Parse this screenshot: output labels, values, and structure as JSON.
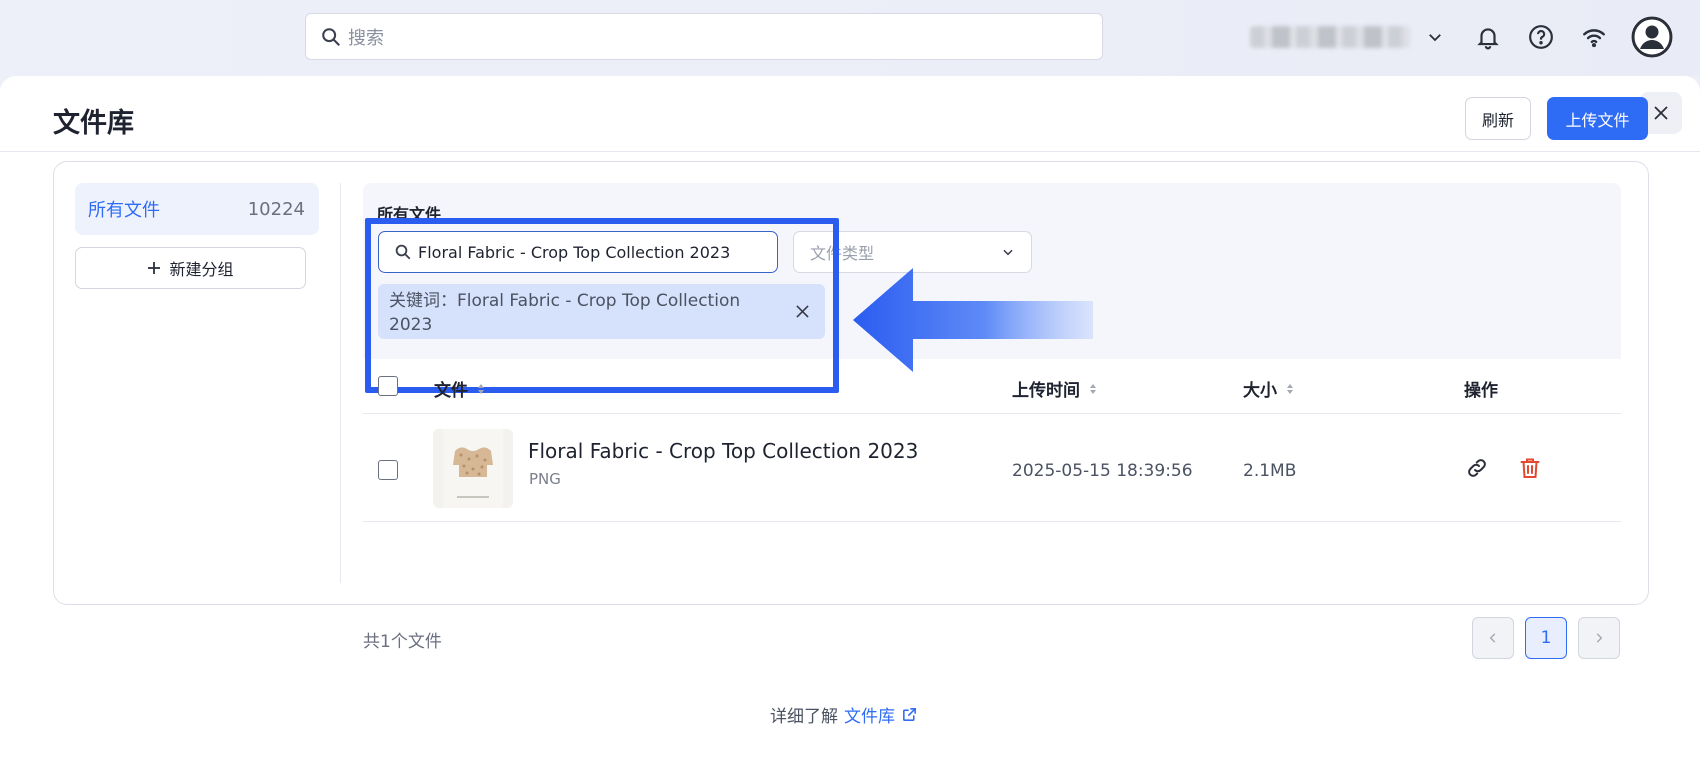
{
  "topbar": {
    "search_placeholder": "搜索"
  },
  "page": {
    "title": "文件库",
    "refresh_label": "刷新",
    "upload_label": "上传文件"
  },
  "sidebar": {
    "all_files_label": "所有文件",
    "all_files_count": "10224",
    "new_group_label": "新建分组"
  },
  "filter": {
    "section_title": "所有文件",
    "keyword_value": "Floral Fabric - Crop Top Collection 2023",
    "type_placeholder": "文件类型",
    "active_tag": "关键词：Floral Fabric - Crop Top Collection 2023"
  },
  "table": {
    "headers": {
      "file": "文件",
      "upload_time": "上传时间",
      "size": "大小",
      "actions": "操作"
    },
    "rows": [
      {
        "name": "Floral Fabric - Crop Top Collection 2023",
        "type": "PNG",
        "upload_time": "2025-05-15 18:39:56",
        "size": "2.1MB"
      }
    ]
  },
  "pagination": {
    "total_text": "共1个文件",
    "current_page": "1"
  },
  "footer": {
    "prefix": "详细了解",
    "link_label": "文件库"
  },
  "colors": {
    "accent": "#2f6cf6",
    "highlight_box": "#2a5cf0",
    "delete": "#e2492f"
  }
}
